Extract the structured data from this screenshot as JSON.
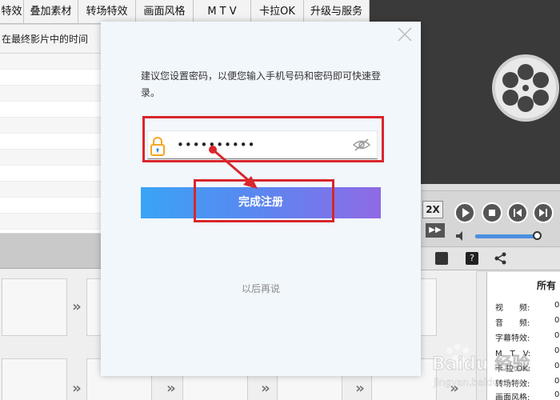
{
  "tabs": [
    {
      "label": "特效"
    },
    {
      "label": "叠加素材"
    },
    {
      "label": "转场特效"
    },
    {
      "label": "画面风格"
    },
    {
      "label": "M T V"
    },
    {
      "label": "卡拉OK"
    },
    {
      "label": "升级与服务"
    }
  ],
  "subheader": {
    "text": "在最终影片中的时间"
  },
  "player": {
    "speed_label": "2X"
  },
  "info_panel": {
    "title": "所有",
    "rows": [
      {
        "label": "视　　频:",
        "value": "0"
      },
      {
        "label": "音　　频:",
        "value": "0"
      },
      {
        "label": "字幕特效:",
        "value": "0"
      },
      {
        "label": "M　T　V:",
        "value": "0"
      },
      {
        "label": "卡 拉 OK:",
        "value": "0"
      },
      {
        "label": "转场特效:",
        "value": "0"
      },
      {
        "label": "画面风格:",
        "value": "0"
      }
    ]
  },
  "modal": {
    "intro": "建议您设置密码，以便您输入手机号码和密码即可快速登录。",
    "password_value": "••••••••••",
    "submit_label": "完成注册",
    "later_label": "以后再说"
  },
  "watermark": {
    "text": "Baidu 经验",
    "sub": "jingyan.baidu.com"
  },
  "colors": {
    "annotation_red": "#d8262c",
    "gradient_start": "#3aa4f5",
    "gradient_end": "#8f6ae6",
    "lock_orange": "#f5a623"
  }
}
